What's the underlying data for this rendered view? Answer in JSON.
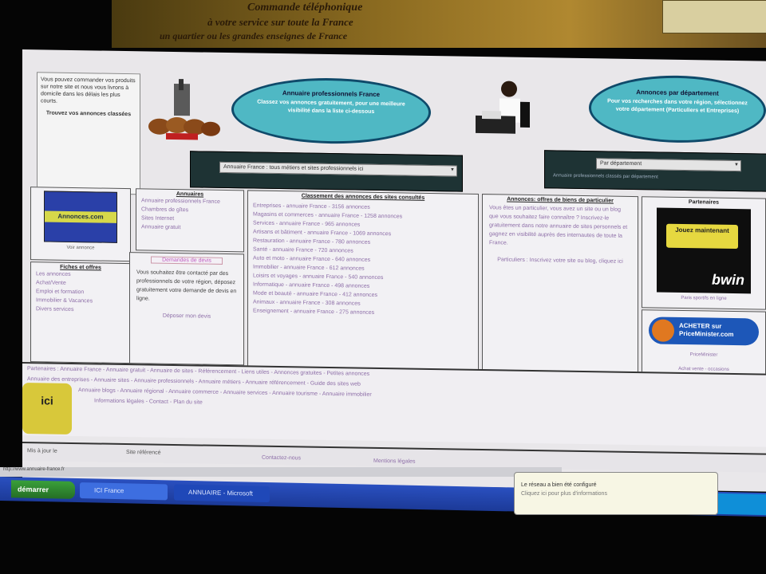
{
  "top_banner": {
    "line1": "Commande téléphonique",
    "line2": "à votre service sur toute la France",
    "line3": "un quartier ou les grandes enseignes de France"
  },
  "left_box": {
    "text": "Vous pouvez commander vos produits sur notre site et nous vous livrons à domicile dans les délais les plus courts.",
    "bold": "Trouvez vos annonces classées"
  },
  "bubble_left": {
    "title": "Annuaire professionnels France",
    "text": "Classez vos annonces gratuitement, pour une meilleure visibilité dans la liste ci-dessous"
  },
  "bubble_right": {
    "title": "Annonces par département",
    "text": "Pour vos recherches dans votre région, sélectionnez votre département (Particuliers et Entreprises)"
  },
  "select_left": {
    "value": "Annuaire France : tous métiers et sites professionnels ici"
  },
  "select_right": {
    "value": "Par département",
    "link": "Annuaire professionnels classés par département"
  },
  "partner_box": {
    "banner": "Annonces.com",
    "link": "Voir annonce"
  },
  "annuaires": {
    "title": "Annuaires",
    "items": [
      "Annuaire professionnels France",
      "Chambres de gîtes",
      "Sites Internet",
      "Annuaire gratuit"
    ]
  },
  "fiches": {
    "title": "Fiches et offres",
    "items": [
      "Les annonces",
      "Achat/Vente",
      "Emploi et formation",
      "Immobilier & Vacances",
      "Divers services"
    ]
  },
  "pub_box": {
    "title": "Demandes de devis",
    "text": "Vous souhaitez être contacté par des professionnels de votre région, déposez gratuitement votre demande de devis en ligne.",
    "link": "Déposer mon devis"
  },
  "classement": {
    "title": "Classement des annonces des sites consultés",
    "items": [
      "Entreprises - annuaire France - 3156 annonces",
      "Magasins et commerces - annuaire France - 1258 annonces",
      "Services - annuaire France - 965 annonces",
      "Artisans et bâtiment - annuaire France - 1069 annonces",
      "Restauration - annuaire France - 780 annonces",
      "Santé - annuaire France - 720 annonces",
      "Auto et moto - annuaire France - 640 annonces",
      "Immobilier - annuaire France - 612 annonces",
      "Loisirs et voyages - annuaire France - 540 annonces",
      "Informatique - annuaire France - 498 annonces",
      "Mode et beauté - annuaire France - 412 annonces",
      "Animaux - annuaire France - 308 annonces",
      "Enseignement - annuaire France - 275 annonces"
    ]
  },
  "annonces": {
    "title": "Annonces: offres de biens de particulier",
    "text": "Vous êtes un particulier, vous avez un site ou un blog que vous souhaitez faire connaître ? Inscrivez-le gratuitement dans notre annuaire de sites personnels et gagnez en visibilité auprès des internautes de toute la France.",
    "footer": "Particuliers : Inscrivez votre site ou blog, cliquez ici"
  },
  "partners": {
    "title": "Partenaires",
    "bwin_main": "Jouez maintenant",
    "bwin_logo": "bwin",
    "bwin_caption": "Paris sportifs en ligne",
    "acheter": "ACHETER sur PriceMinister.com",
    "acheter_caption": "PriceMinister",
    "acheter_link": "Achat vente - occasions"
  },
  "footer": {
    "row1": "Partenaires : Annuaire France - Annuaire gratuit - Annuaire de sites - Référencement - Liens utiles - Annonces gratuites - Petites annonces",
    "row2": "Annuaire des entreprises - Annuaire sites - Annuaire professionnels - Annuaire métiers - Annuaire référencement - Guide des sites web",
    "row3": "Annuaire blogs - Annuaire régional - Annuaire commerce - Annuaire services - Annuaire tourisme - Annuaire immobilier",
    "row4": "Informations légales - Contact - Plan du site",
    "ici": "ici"
  },
  "bottom": {
    "left": "Mis à jour le",
    "mid": "Site référencé",
    "link1": "Contactez-nous",
    "link2": "Mentions légales"
  },
  "taskbar": {
    "start": "démarrer",
    "btn1": "ICI France",
    "btn2": "ANNUAIRE - Microsoft"
  },
  "toast": {
    "line1": "Le réseau a bien été configuré",
    "line2": "Cliquez ici pour plus d'informations"
  },
  "urlbar": "http://www.annuaire-france.fr"
}
